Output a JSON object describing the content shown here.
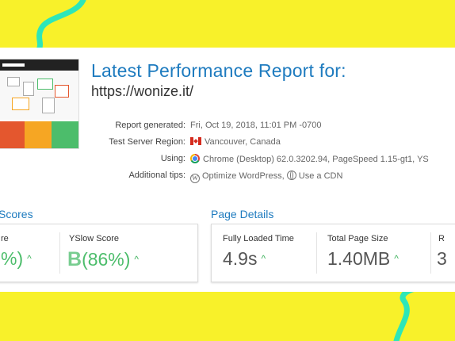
{
  "colors": {
    "accent": "#1e7bbf",
    "green": "#4cbd6b",
    "band": "#f8f12a",
    "swirl": "#2ee6b8"
  },
  "report": {
    "title": "Latest Performance Report for:",
    "url": "https://wonize.it/",
    "rows": [
      {
        "label": "Report generated:",
        "value": "Fri, Oct 19, 2018, 11:01 PM -0700",
        "icon": "none"
      },
      {
        "label": "Test Server Region:",
        "value": "Vancouver, Canada",
        "icon": "canada-flag-icon"
      },
      {
        "label": "Using:",
        "value": "Chrome (Desktop) 62.0.3202.94, PageSpeed 1.15-gt1, YS",
        "icon": "chrome-icon"
      },
      {
        "label": "Additional tips:",
        "value": "Optimize WordPress,",
        "value2": "Use a CDN",
        "icon": "wordpress-icon"
      }
    ]
  },
  "scores": {
    "heading": "Scores",
    "items": [
      {
        "label": "re",
        "value": "%)",
        "icon": "caret-up-icon"
      },
      {
        "label": "YSlow Score",
        "grade": "B",
        "value": "(86%)",
        "icon": "caret-up-icon"
      }
    ]
  },
  "details": {
    "heading": "Page Details",
    "items": [
      {
        "label": "Fully Loaded Time",
        "value": "4.9s"
      },
      {
        "label": "Total Page Size",
        "value": "1.40MB"
      },
      {
        "label": "R",
        "value": "3"
      }
    ]
  },
  "thumbnail": {
    "bottom_colors": [
      "#e4572e",
      "#f6a623",
      "#4cbd6b"
    ]
  }
}
